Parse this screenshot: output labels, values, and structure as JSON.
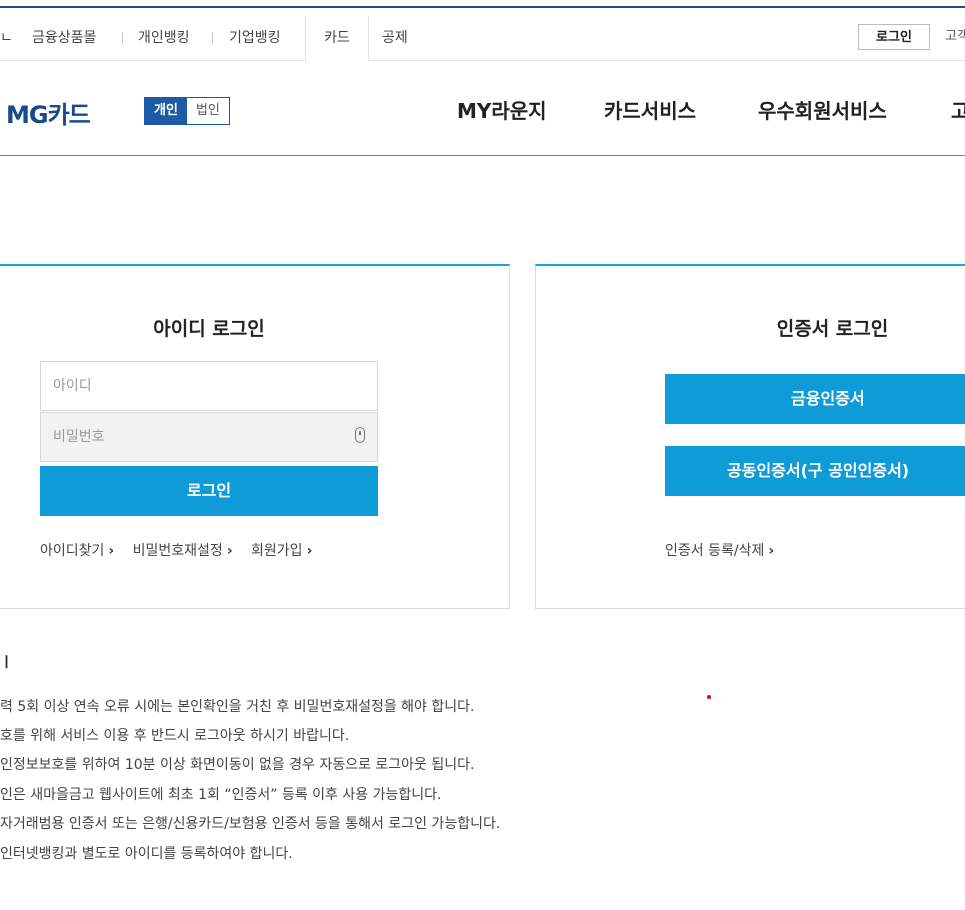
{
  "util_nav": {
    "items": [
      "금융상품몰",
      "개인뱅킹",
      "기업뱅킹",
      "카드",
      "공제"
    ],
    "active": "카드",
    "login_label": "로그인",
    "right_partial": "고객"
  },
  "header": {
    "logo": "MG카드",
    "toggle": {
      "personal": "개인",
      "corporate": "법인"
    },
    "menu": [
      "MY라운지",
      "카드서비스",
      "우수회원서비스",
      "고"
    ]
  },
  "id_login": {
    "title": "아이디 로그인",
    "id_placeholder": "아이디",
    "pw_placeholder": "비밀번호",
    "login_button": "로그인",
    "links": [
      "아이디찾기",
      "비밀번호재설정",
      "회원가입"
    ]
  },
  "cert_login": {
    "title": "인증서 로그인",
    "fin_cert_button": "금융인증서",
    "joint_cert_button": "공동인증서(구 공인인증서)",
    "manage_link": "인증서 등록/삭제"
  },
  "notice": {
    "title": "ㅣ",
    "lines": [
      "력 5회 이상 연속 오류 시에는 본인확인을 거친 후 비밀번호재설정을 해야 합니다.",
      "호를 위해 서비스 이용 후 반드시 로그아웃 하시기 바랍니다.",
      "인정보보호를 위하여 10분 이상 화면이동이 없을 경우 자동으로 로그아웃 됩니다.",
      "인은 새마을금고 웹사이트에 최초 1회 “인증서” 등록 이후 사용 가능합니다.",
      "자거래범용 인증서 또는 은행/신용카드/보험용 인증서 등을 통해서 로그인 가능합니다.",
      "인터넷뱅킹과 별도로 아이디를 등록하여야 합니다."
    ]
  },
  "colors": {
    "brand_navy": "#174b8b",
    "accent_blue": "#0f9ad8",
    "toggle_blue": "#1d5aa6"
  },
  "icons": {
    "pw_field_icon": "mouse-keyboard-icon",
    "link_arrow": "chevron-right-icon"
  }
}
